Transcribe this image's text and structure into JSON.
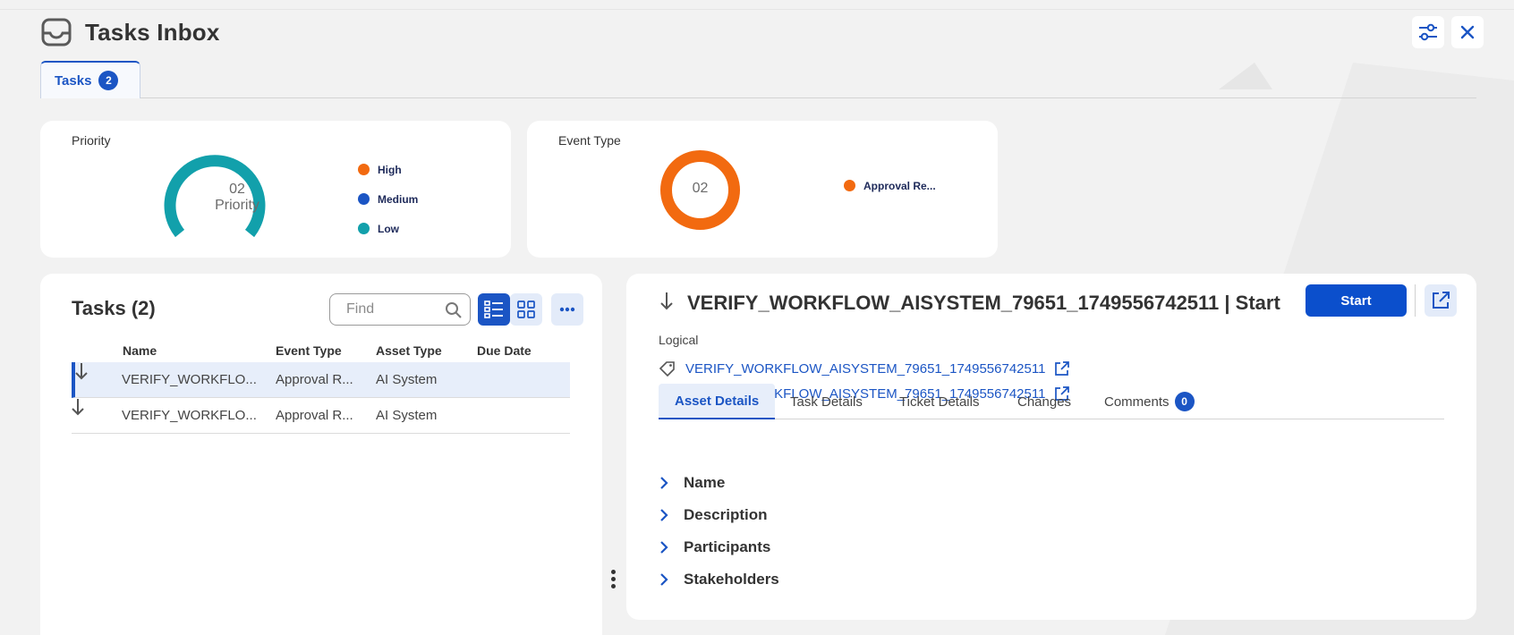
{
  "header": {
    "title": "Tasks Inbox"
  },
  "tabs": [
    {
      "label": "Tasks",
      "count": "2"
    }
  ],
  "priority_card": {
    "title": "Priority",
    "center_value": "02",
    "center_label": "Priority",
    "legend": [
      {
        "label": "High",
        "color": "#f26a10"
      },
      {
        "label": "Medium",
        "color": "#1b55c4"
      },
      {
        "label": "Low",
        "color": "#12a0ab"
      }
    ]
  },
  "event_card": {
    "title": "Event Type",
    "center_value": "02",
    "legend": [
      {
        "label": "Approval Re...",
        "color": "#f26a10"
      }
    ]
  },
  "task_list": {
    "title": "Tasks (2)",
    "search_placeholder": "Find",
    "columns": [
      "Name",
      "Event Type",
      "Asset Type",
      "Due Date"
    ],
    "rows": [
      {
        "name": "VERIFY_WORKFLO...",
        "event_type": "Approval R...",
        "asset_type": "AI System",
        "due_date": "",
        "selected": true
      },
      {
        "name": "VERIFY_WORKFLO...",
        "event_type": "Approval R...",
        "asset_type": "AI System",
        "due_date": "",
        "selected": false
      }
    ]
  },
  "detail": {
    "title": "VERIFY_WORKFLOW_AISYSTEM_79651_1749556742511 | Start",
    "start_label": "Start",
    "subtitle": "Logical",
    "links": [
      {
        "icon": "tag-icon",
        "text": "VERIFY_WORKFLOW_AISYSTEM_79651_1749556742511"
      },
      {
        "icon": "cloud-gear-icon",
        "text": "VERIFY_WORKFLOW_AISYSTEM_79651_1749556742511"
      }
    ],
    "tabs": [
      {
        "label": "Asset Details",
        "active": true
      },
      {
        "label": "Task Details"
      },
      {
        "label": "Ticket Details"
      },
      {
        "label": "Changes"
      },
      {
        "label": "Comments",
        "count": "0"
      }
    ],
    "sections": [
      "Name",
      "Description",
      "Participants",
      "Stakeholders"
    ]
  },
  "colors": {
    "accent": "#1b55c4",
    "orange": "#f26a10",
    "teal": "#12a0ab"
  }
}
